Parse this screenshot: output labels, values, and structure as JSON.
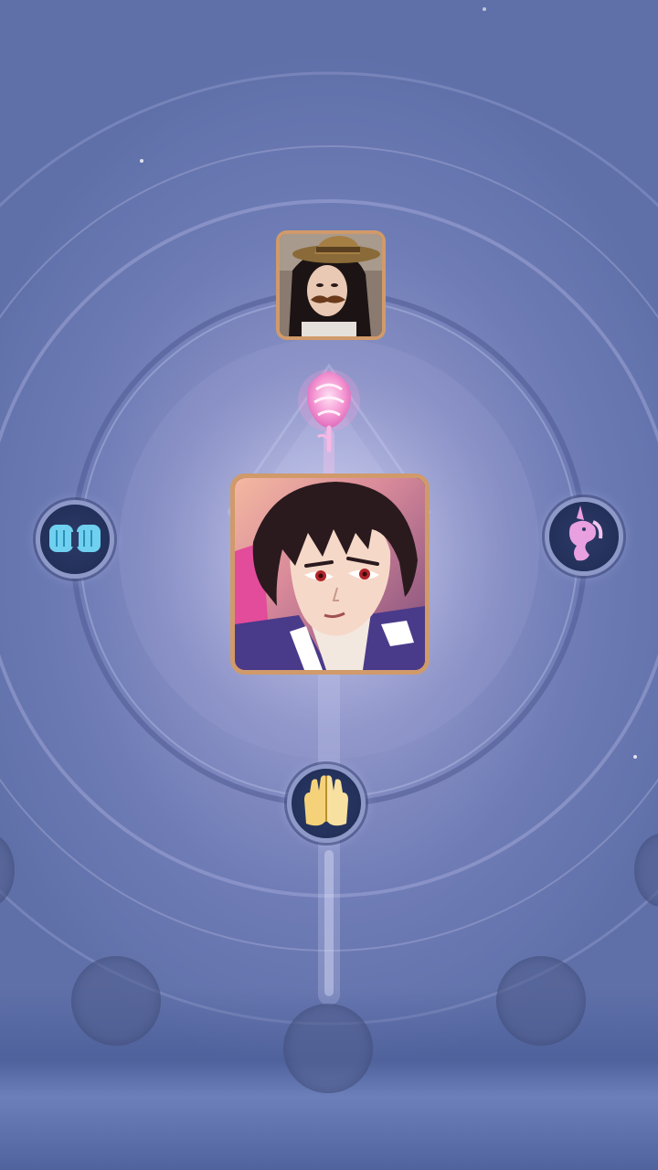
{
  "scene": {
    "type": "relationship-map",
    "background_color": "#7a86bf",
    "frame_color": "#d09a6a"
  },
  "center_character": {
    "portrait": "anime-young-man-dark-hair-red-eyes",
    "hair_color": "#2a1a1a",
    "eye_color": "#b0242a"
  },
  "top_character": {
    "portrait": "photo-girl-with-hat-and-mustache"
  },
  "gift_icon": "pink-rose-icon",
  "nodes": [
    {
      "id": "left",
      "icon": "fist-bump-icon",
      "color": "#6fd0f0"
    },
    {
      "id": "right",
      "icon": "unicorn-icon",
      "color": "#e8a0e0"
    },
    {
      "id": "bottom",
      "icon": "high-five-icon",
      "color": "#f5d27a"
    }
  ],
  "empty_slots": 5
}
